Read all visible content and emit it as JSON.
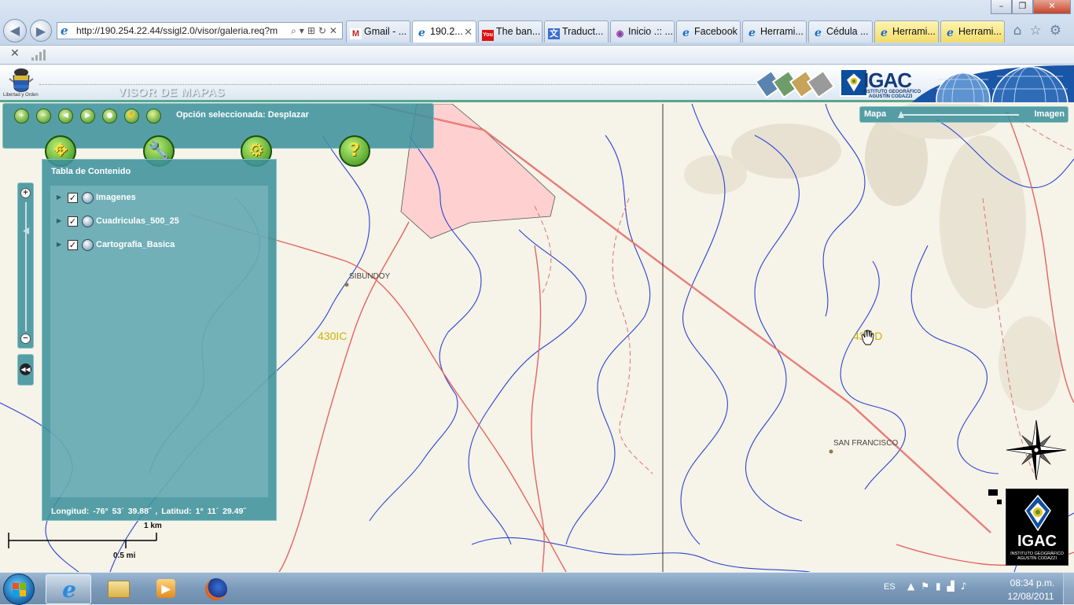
{
  "browser": {
    "address_url": "http://190.254.22.44/ssigl2.0/visor/galeria.req?m",
    "tabs": [
      {
        "label": "Gmail - ...",
        "icon": "gmail-icon",
        "style": "normal"
      },
      {
        "label": "190.2...",
        "icon": "ie-page-icon",
        "style": "active",
        "closable": true
      },
      {
        "label": "The ban...",
        "icon": "youtube-icon",
        "style": "normal"
      },
      {
        "label": "Traduct...",
        "icon": "translate-icon",
        "style": "normal"
      },
      {
        "label": "Inicio .:: ...",
        "icon": "page-icon",
        "style": "normal"
      },
      {
        "label": "Facebook",
        "icon": "ie-page-icon",
        "style": "normal"
      },
      {
        "label": "Herrami...",
        "icon": "ie-page-icon",
        "style": "normal"
      },
      {
        "label": "Cédula ...",
        "icon": "ie-page-icon",
        "style": "normal"
      },
      {
        "label": "Herrami...",
        "icon": "ie-page-icon",
        "style": "yellow"
      },
      {
        "label": "Herrami...",
        "icon": "ie-page-icon",
        "style": "yellow"
      }
    ]
  },
  "header": {
    "coat_of_arms_caption": "Libertad y Orden",
    "title": "VISOR DE MAPAS",
    "brand": "IGAC",
    "brand_sub_line1": "INSTITUTO GEOGRÁFICO",
    "brand_sub_line2": "AGUSTÍN CODAZZI"
  },
  "toolbar": {
    "status": "Opción seleccionada: Desplazar",
    "small_tools": [
      "zoom-in-tool",
      "zoom-out-tool",
      "back-tool",
      "forward-tool",
      "full-extent-tool",
      "pan-tool",
      "identify-tool"
    ]
  },
  "toc": {
    "title": "Tabla de Contenido",
    "layers": [
      {
        "name": "Imagenes",
        "checked": true
      },
      {
        "name": "Cuadriculas_500_25",
        "checked": true
      },
      {
        "name": "Cartografia_Basica",
        "checked": true
      }
    ],
    "coordinates": "Longitud: -76° 53´   39.88˝ , Latitud: 1° 11´   29.49˝"
  },
  "slider": {
    "left_label": "Mapa",
    "right_label": "Imagen",
    "level": 0
  },
  "map": {
    "place_labels": [
      "SIBUNDOY",
      "SAN FRANCISCO"
    ],
    "grid_labels": [
      "430IC",
      "430ID"
    ]
  },
  "scale": {
    "km_label": "1 km",
    "mi_label": "0.5 mi"
  },
  "logo": {
    "text": "IGAC",
    "sub_line1": "INSTITUTO GEOGRÁFICO",
    "sub_line2": "AGUSTÍN CODAZZI"
  },
  "taskbar": {
    "language": "ES",
    "time": "08:34 p.m.",
    "date": "12/08/2011"
  },
  "colors": {
    "panel": "#40929c",
    "river": "#1f3fd6",
    "road": "#e0625a",
    "restricted_area": "#ffcccc",
    "map_background": "#f6f3e8"
  }
}
